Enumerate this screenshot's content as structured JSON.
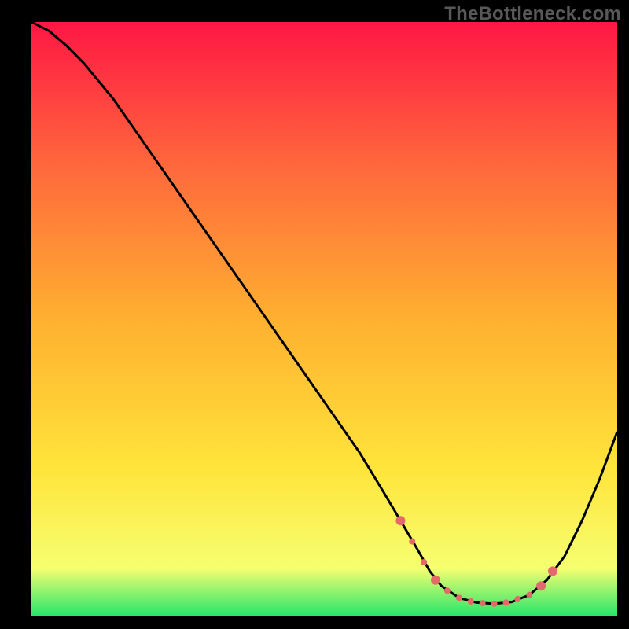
{
  "watermark": "TheBottleneck.com",
  "colors": {
    "gradient": [
      "#ff1744",
      "#ff6a3c",
      "#ffb030",
      "#ffe43a",
      "#f6ff70",
      "#28e66b"
    ],
    "line": "#000000",
    "markers": "#e46a6a",
    "background_outer": "#000000"
  },
  "chart_data": {
    "type": "line",
    "title": "",
    "xlabel": "",
    "ylabel": "",
    "xlim": [
      0,
      100
    ],
    "ylim": [
      0,
      100
    ],
    "x": [
      0,
      3,
      6,
      9,
      14,
      20,
      26,
      32,
      38,
      44,
      50,
      56,
      60,
      63,
      66,
      68,
      70,
      73,
      76,
      79,
      82,
      85,
      88,
      91,
      94,
      97,
      100
    ],
    "y": [
      100,
      98.5,
      96,
      93,
      87,
      78.5,
      70,
      61.5,
      53,
      44.5,
      36,
      27.5,
      21,
      16,
      11,
      7.5,
      5,
      3,
      2.2,
      2,
      2.3,
      3.5,
      6,
      10,
      16,
      23,
      31
    ],
    "markers": {
      "x": [
        63,
        65,
        67,
        69,
        71,
        73,
        75,
        77,
        79,
        81,
        83,
        85,
        87,
        89
      ],
      "y": [
        16,
        12.5,
        9,
        6,
        4.2,
        3,
        2.4,
        2.1,
        2,
        2.2,
        2.8,
        3.5,
        5,
        7.5
      ],
      "size": [
        6,
        4,
        4,
        6,
        4,
        4,
        4,
        4,
        4,
        4,
        4,
        4,
        6,
        6
      ]
    }
  }
}
